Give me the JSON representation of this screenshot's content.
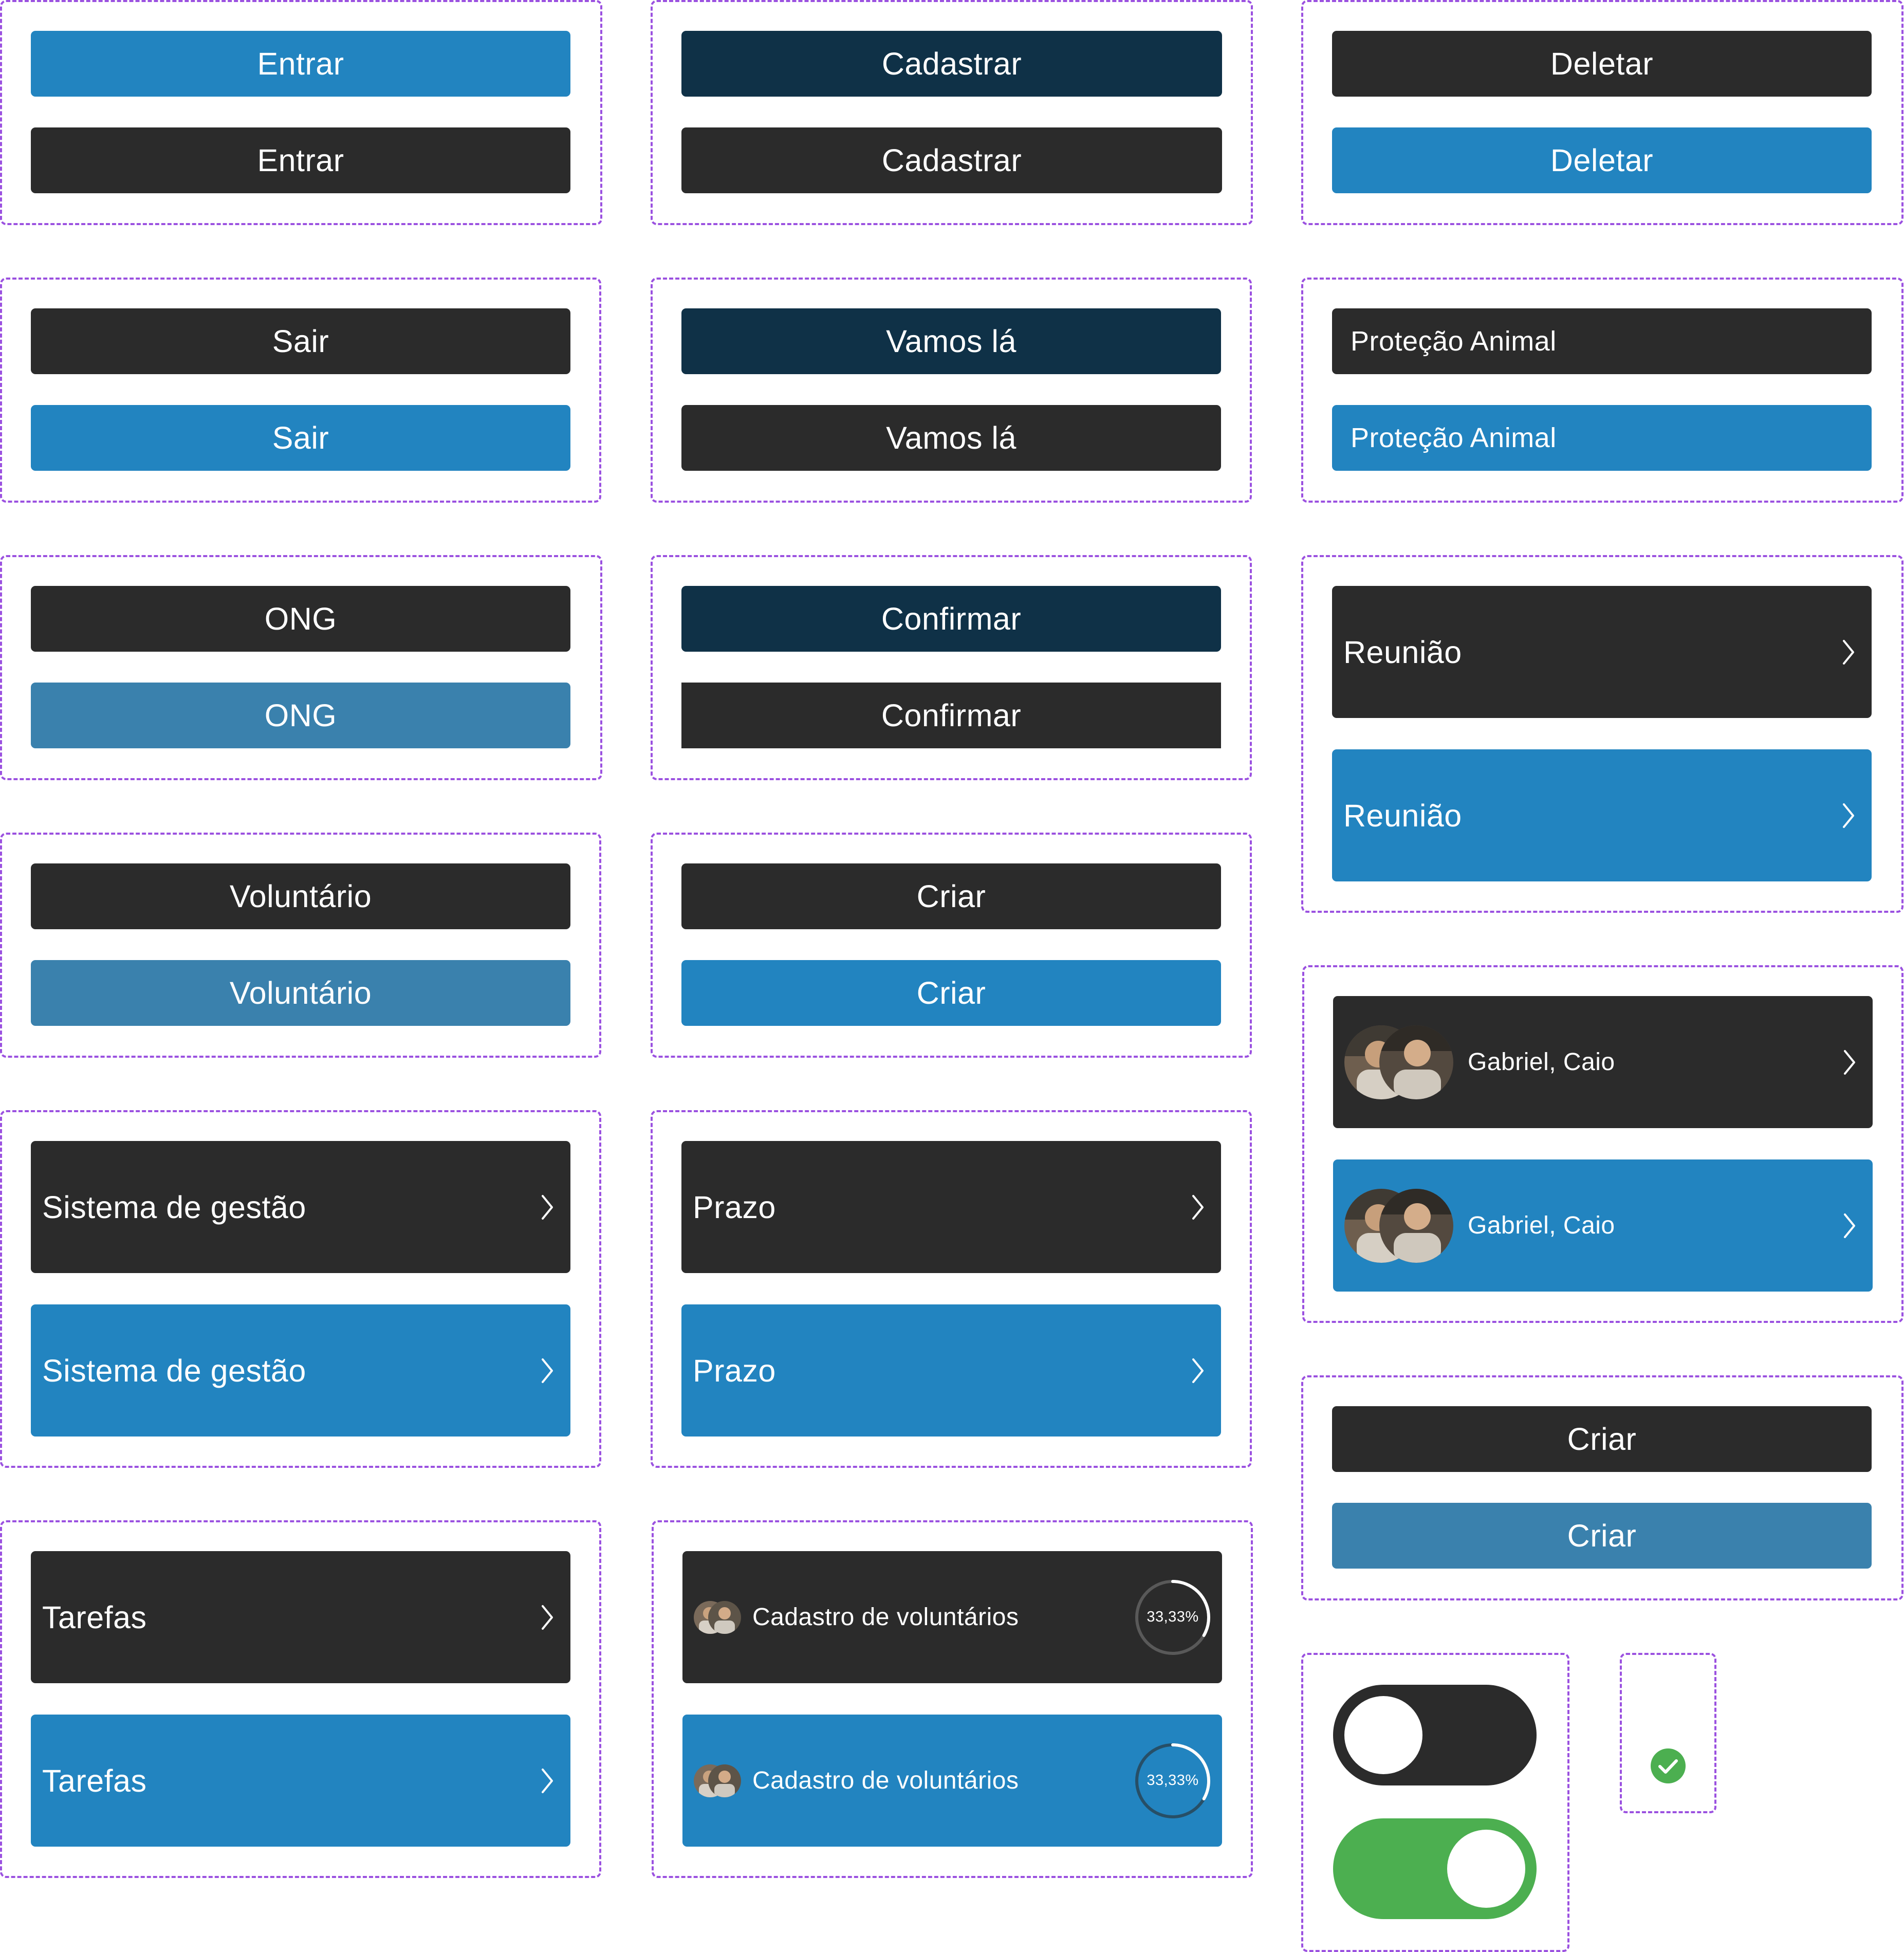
{
  "buttons": {
    "entrar": "Entrar",
    "cadastrar": "Cadastrar",
    "deletar": "Deletar",
    "sair": "Sair",
    "vamos_la": "Vamos lá",
    "protecao_animal": "Proteção Animal",
    "ong": "ONG",
    "confirmar": "Confirmar",
    "reuniao": "Reunião",
    "voluntario": "Voluntário",
    "criar": "Criar",
    "sistema_de_gestao": "Sistema de gestão",
    "prazo": "Prazo",
    "gabriel_caio": "Gabriel, Caio",
    "tarefas": "Tarefas",
    "cadastro_de_voluntarios": "Cadastro de voluntários"
  },
  "progress": {
    "percent_label": "33,33%",
    "value": 0.3333
  },
  "toggles": {
    "off": false,
    "on": true
  },
  "colors": {
    "dark": "#2b2b2b",
    "navy": "#0f3147",
    "blue": "#2284c0",
    "steel": "#3a81ad",
    "green": "#4caf50",
    "frame": "#9b51e0"
  }
}
